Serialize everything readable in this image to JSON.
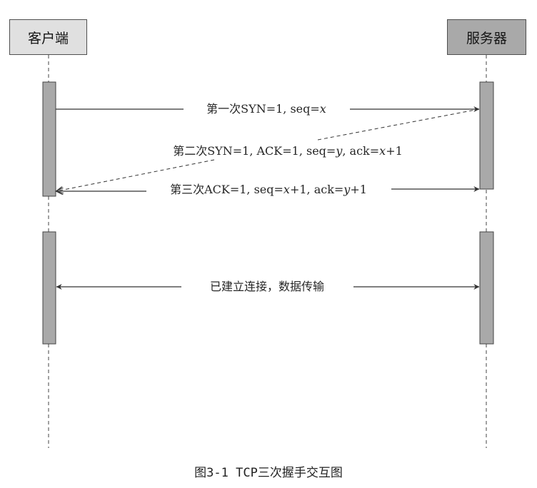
{
  "actors": {
    "client": {
      "label": "客户端",
      "fill": "#e0e0e0"
    },
    "server": {
      "label": "服务器",
      "fill": "#a9a9a9"
    }
  },
  "messages": [
    {
      "parts": [
        {
          "text": "第一次SYN=1, seq=",
          "italic": false
        },
        {
          "text": "x",
          "italic": true
        }
      ],
      "from": "client",
      "to": "server",
      "style": "solid"
    },
    {
      "parts": [
        {
          "text": "第二次SYN=1, ACK=1, seq=",
          "italic": false
        },
        {
          "text": "y",
          "italic": true
        },
        {
          "text": ", ack=",
          "italic": false
        },
        {
          "text": "x",
          "italic": true
        },
        {
          "text": "+1",
          "italic": false
        }
      ],
      "from": "server",
      "to": "client",
      "style": "dashed"
    },
    {
      "parts": [
        {
          "text": "第三次ACK=1, seq=",
          "italic": false
        },
        {
          "text": "x",
          "italic": true
        },
        {
          "text": "+1, ack=",
          "italic": false
        },
        {
          "text": "y",
          "italic": true
        },
        {
          "text": "+1",
          "italic": false
        }
      ],
      "from": "client",
      "to": "server",
      "style": "solid"
    },
    {
      "parts": [
        {
          "text": "已建立连接，数据传输",
          "italic": false
        }
      ],
      "from": "client",
      "to": "server",
      "style": "bidirectional"
    }
  ],
  "caption": "图3-1  TCP三次握手交互图",
  "colors": {
    "activation_bar": "#a9a9a9",
    "line": "#333333"
  }
}
